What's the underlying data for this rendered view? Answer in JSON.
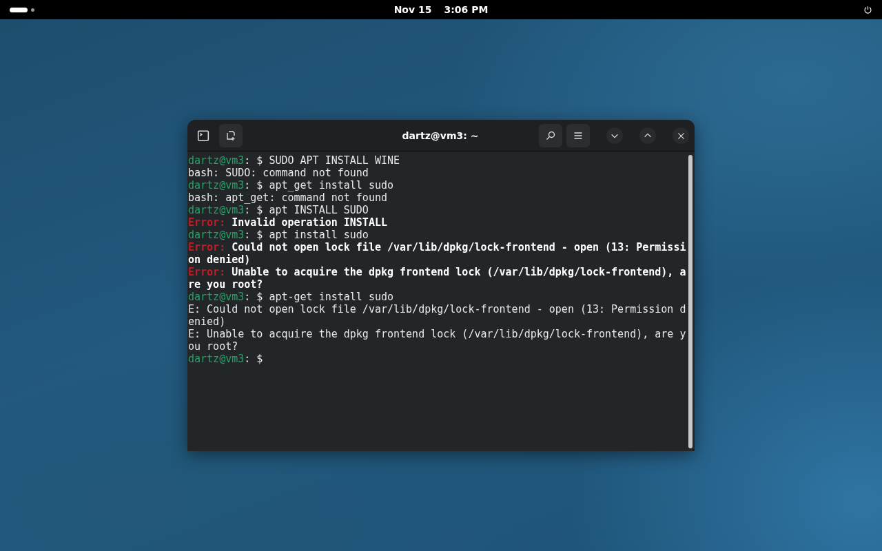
{
  "top_bar": {
    "date": "Nov 15",
    "time": "3:06 PM"
  },
  "window": {
    "title": "dartz@vm3: ~"
  },
  "terminal": {
    "lines": [
      [
        {
          "kind": "prompt",
          "text": "dartz@vm3"
        },
        {
          "kind": "plain",
          "text": ": $ SUDO APT INSTALL WINE"
        }
      ],
      [
        {
          "kind": "plain",
          "text": "bash: SUDO: command not found"
        }
      ],
      [
        {
          "kind": "prompt",
          "text": "dartz@vm3"
        },
        {
          "kind": "plain",
          "text": ": $ apt_get install sudo"
        }
      ],
      [
        {
          "kind": "plain",
          "text": "bash: apt_get: command not found"
        }
      ],
      [
        {
          "kind": "prompt",
          "text": "dartz@vm3"
        },
        {
          "kind": "plain",
          "text": ": $ apt INSTALL SUDO"
        }
      ],
      [
        {
          "kind": "error",
          "text": "Error:"
        },
        {
          "kind": "bold",
          "text": " Invalid operation INSTALL"
        }
      ],
      [
        {
          "kind": "prompt",
          "text": "dartz@vm3"
        },
        {
          "kind": "plain",
          "text": ": $ apt install sudo"
        }
      ],
      [
        {
          "kind": "error",
          "text": "Error:"
        },
        {
          "kind": "bold",
          "text": " Could not open lock file /var/lib/dpkg/lock-frontend - open (13: Permissi"
        }
      ],
      [
        {
          "kind": "bold",
          "text": "on denied)"
        }
      ],
      [
        {
          "kind": "error",
          "text": "Error:"
        },
        {
          "kind": "bold",
          "text": " Unable to acquire the dpkg frontend lock (/var/lib/dpkg/lock-frontend), a"
        }
      ],
      [
        {
          "kind": "bold",
          "text": "re you root?"
        }
      ],
      [
        {
          "kind": "prompt",
          "text": "dartz@vm3"
        },
        {
          "kind": "plain",
          "text": ": $ apt-get install sudo"
        }
      ],
      [
        {
          "kind": "plain",
          "text": "E: Could not open lock file /var/lib/dpkg/lock-frontend - open (13: Permission d"
        }
      ],
      [
        {
          "kind": "plain",
          "text": "enied)"
        }
      ],
      [
        {
          "kind": "plain",
          "text": "E: Unable to acquire the dpkg frontend lock (/var/lib/dpkg/lock-frontend), are y"
        }
      ],
      [
        {
          "kind": "plain",
          "text": "ou root?"
        }
      ],
      [
        {
          "kind": "prompt",
          "text": "dartz@vm3"
        },
        {
          "kind": "plain",
          "text": ": $"
        }
      ]
    ]
  }
}
